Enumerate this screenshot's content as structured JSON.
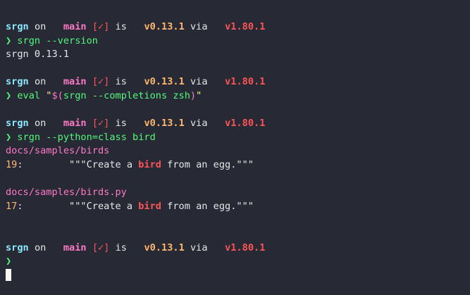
{
  "prompt": {
    "user": "srgn",
    "on": "on",
    "branch": "main",
    "git_status": "[✓]",
    "is": "is",
    "pkg_version": "v0.13.1",
    "via": "via",
    "rust_version": "v1.80.1",
    "chevron": "❯"
  },
  "blocks": [
    {
      "command": "srgn --version",
      "output": [
        "srgn 0.13.1"
      ]
    },
    {
      "command_parts": {
        "pre": "eval ",
        "quote_open": "\"",
        "subst_open": "$(",
        "inner": "srgn --completions zsh",
        "subst_close": ")",
        "quote_close": "\""
      }
    },
    {
      "command": "srgn --python=class bird",
      "results": [
        {
          "path": "docs/samples/birds",
          "line_no": "19",
          "before": "        \"\"\"Create a ",
          "match": "bird",
          "after": " from an egg.\"\"\""
        },
        {
          "path": "docs/samples/birds.py",
          "line_no": "17",
          "before": "        \"\"\"Create a ",
          "match": "bird",
          "after": " from an egg.\"\"\""
        }
      ]
    }
  ],
  "colors": {
    "background": "#272935",
    "user": "#8be9fd",
    "branch": "#ff79c6",
    "version": "#ffb86c",
    "rust": "#ff5555",
    "chevron": "#50fa7b"
  }
}
